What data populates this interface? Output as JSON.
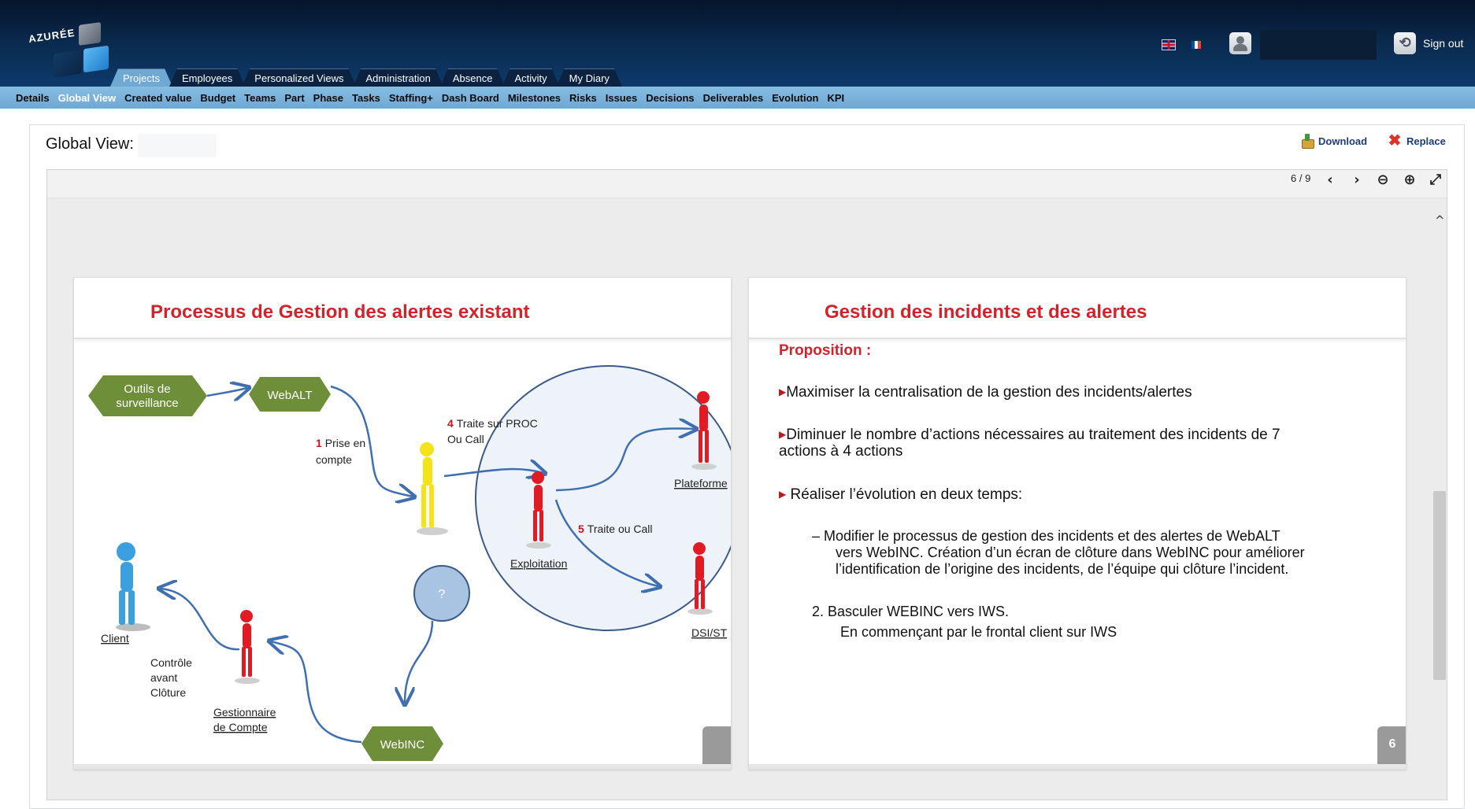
{
  "header": {
    "logo_text": "AZURÉE",
    "language_en": "EN",
    "language_fr": "FR",
    "sign_out_label": "Sign out"
  },
  "main_tabs": [
    "Projects",
    "Employees",
    "Personalized Views",
    "Administration",
    "Absence",
    "Activity",
    "My Diary"
  ],
  "active_main_tab": "Projects",
  "sub_nav": [
    "Details",
    "Global View",
    "Created value",
    "Budget",
    "Teams",
    "Part",
    "Phase",
    "Tasks",
    "Staffing+",
    "Dash Board",
    "Milestones",
    "Risks",
    "Issues",
    "Decisions",
    "Deliverables",
    "Evolution",
    "KPI"
  ],
  "active_sub_nav": "Global View",
  "page": {
    "title": "Global View:",
    "download_label": "Download",
    "replace_label": "Replace"
  },
  "viewer": {
    "page_counter": "6 / 9",
    "prev_icon": "‹",
    "next_icon": "›",
    "zoom_out_icon": "⊖",
    "zoom_in_icon": "⊕",
    "expand_icon": "⤢",
    "scroll_up_icon": "^"
  },
  "slide_left": {
    "title": "Processus de Gestion des alertes existant",
    "nodes": {
      "outils": [
        "Outils de",
        "surveillance"
      ],
      "webalt": "WebALT",
      "webinc": "WebINC",
      "question": "?"
    },
    "labels": {
      "prise_num": "1",
      "prise_line1": "Prise en",
      "prise_line2": "compte",
      "traite4_num": "4",
      "traite4_line1": "Traite sur PROC",
      "traite4_line2": "Ou Call",
      "traite5_num": "5",
      "traite5_text": "Traite ou Call",
      "plateforme": "Plateforme",
      "exploitation": "Exploitation",
      "dsi": "DSI/ST",
      "client": "Client",
      "controle": [
        "Contrôle",
        "avant",
        "Clôture"
      ],
      "gestionnaire": [
        "Gestionnaire",
        "de Compte"
      ]
    }
  },
  "slide_right": {
    "title": "Gestion des incidents et des alertes",
    "proposition": "Proposition :",
    "bullets": [
      "Maximiser la centralisation de la gestion des incidents/alertes",
      "Diminuer le nombre d’actions nécessaires au traitement des incidents de 7",
      "actions à 4 actions",
      "Réaliser  l’évolution en deux temps:"
    ],
    "sub_items": [
      "–    Modifier le processus de gestion des incidents et des alertes de WebALT",
      "vers WebINC. Création d’un écran de clôture dans WebINC pour améliorer",
      "l’identification de l’origine des incidents, de l’équipe qui clôture l’incident.",
      "2.   Basculer WEBINC vers IWS.",
      "En commençant par le frontal client sur IWS"
    ],
    "page_number": "6"
  },
  "colors": {
    "header_dark": "#05152b",
    "subnav_blue": "#6ea8d4",
    "slide_title_red": "#d2232a",
    "hexagon_green": "#6e8e3a",
    "figure_red": "#e01b24",
    "figure_yellow": "#f4e21a",
    "figure_blue": "#3aa0e0",
    "circle_border": "#3a5a8a"
  }
}
